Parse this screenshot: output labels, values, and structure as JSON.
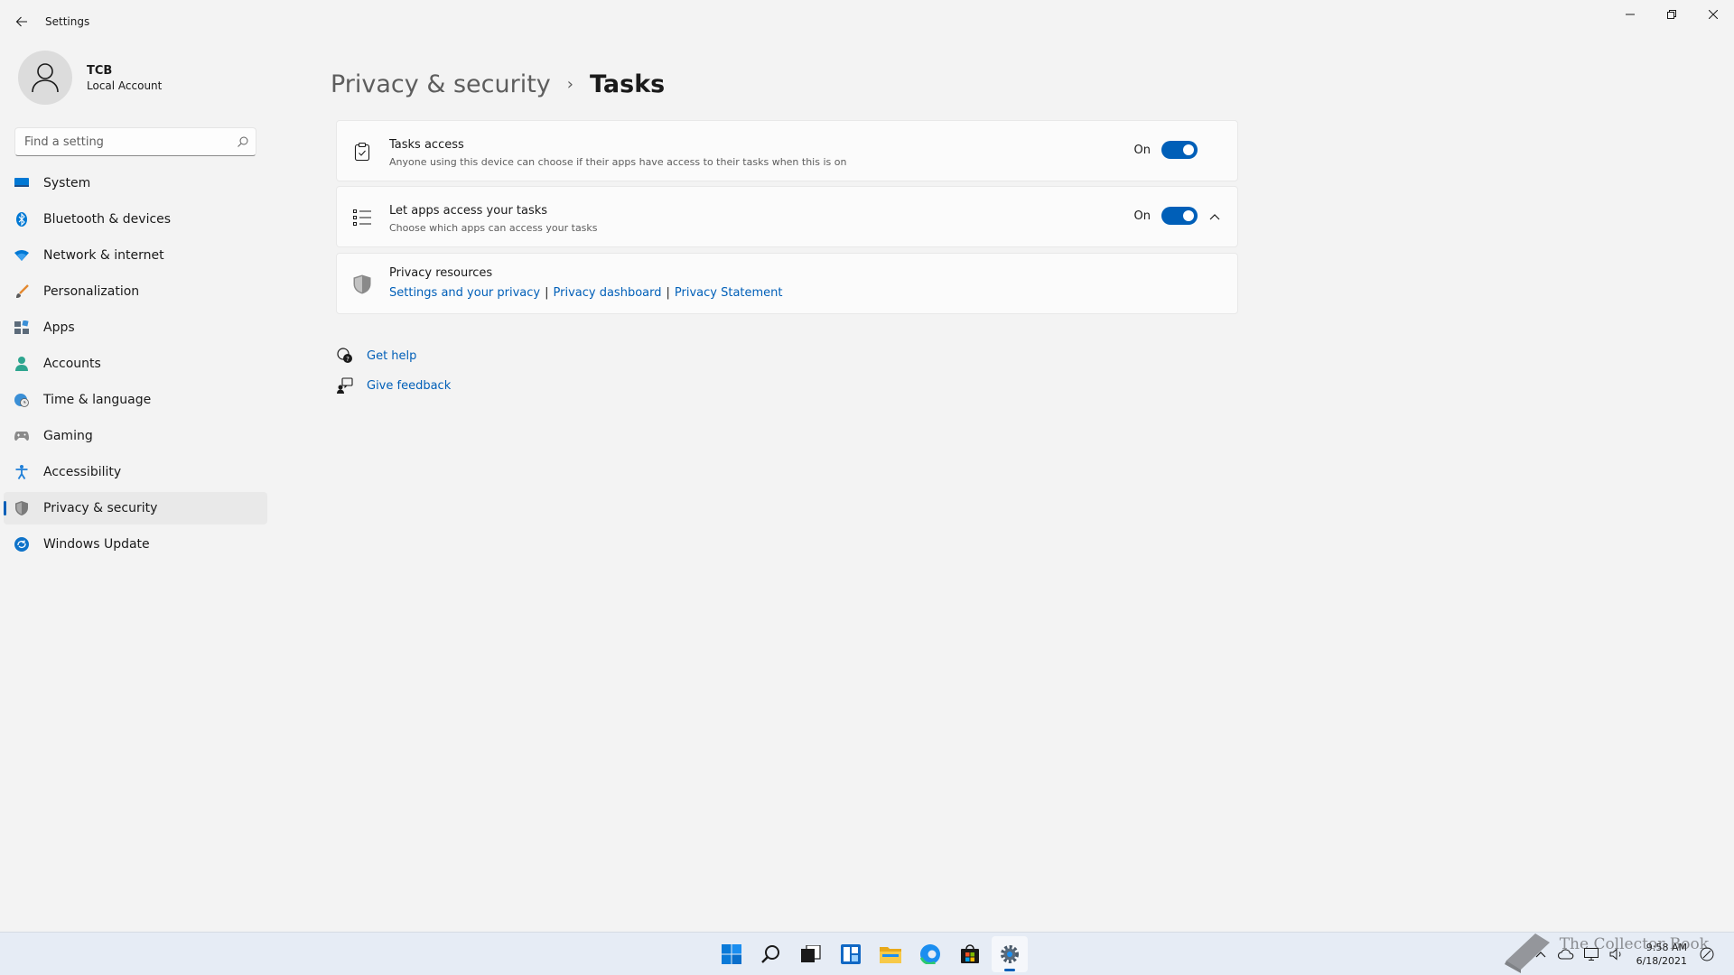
{
  "window": {
    "title": "Settings"
  },
  "profile": {
    "name": "TCB",
    "account_type": "Local Account"
  },
  "search": {
    "placeholder": "Find a setting"
  },
  "sidebar": {
    "items": [
      {
        "label": "System",
        "icon": "monitor-icon",
        "color": "#0078d4"
      },
      {
        "label": "Bluetooth & devices",
        "icon": "bluetooth-icon",
        "color": "#0078d4"
      },
      {
        "label": "Network & internet",
        "icon": "wifi-icon",
        "color": "#0078d4"
      },
      {
        "label": "Personalization",
        "icon": "paintbrush-icon",
        "color": "#e3882f"
      },
      {
        "label": "Apps",
        "icon": "apps-icon",
        "color": "#5c6b7a"
      },
      {
        "label": "Accounts",
        "icon": "person-icon",
        "color": "#2ea58f"
      },
      {
        "label": "Time & language",
        "icon": "globe-clock-icon",
        "color": "#3a8fd6"
      },
      {
        "label": "Gaming",
        "icon": "gamepad-icon",
        "color": "#7a7a7a"
      },
      {
        "label": "Accessibility",
        "icon": "accessibility-icon",
        "color": "#1f7fd8"
      },
      {
        "label": "Privacy & security",
        "icon": "shield-icon",
        "color": "#6b6b6b",
        "active": true
      },
      {
        "label": "Windows Update",
        "icon": "update-icon",
        "color": "#0f73c9"
      }
    ]
  },
  "breadcrumb": {
    "parent": "Privacy & security",
    "separator": "›",
    "current": "Tasks"
  },
  "cards": {
    "tasks_access": {
      "title": "Tasks access",
      "description": "Anyone using this device can choose if their apps have access to their tasks when this is on",
      "state_label": "On",
      "on": true
    },
    "apps_access": {
      "title": "Let apps access your tasks",
      "description": "Choose which apps can access your tasks",
      "state_label": "On",
      "on": true,
      "expanded": true
    },
    "privacy_resources": {
      "title": "Privacy resources",
      "links": [
        "Settings and your privacy",
        "Privacy dashboard",
        "Privacy Statement"
      ],
      "separator": "|"
    }
  },
  "help": {
    "get_help": "Get help",
    "give_feedback": "Give feedback"
  },
  "taskbar": {
    "apps": [
      "windows-start-icon",
      "search-icon",
      "task-view-icon",
      "widgets-icon",
      "file-explorer-icon",
      "edge-icon",
      "store-icon",
      "settings-icon"
    ],
    "active_app": "settings-icon",
    "time": "9:58 AM",
    "date": "6/18/2021"
  },
  "watermark": {
    "text": "The Collector Book"
  },
  "colors": {
    "accent": "#005fb8",
    "background": "#f3f3f3",
    "card": "#fbfbfb"
  }
}
